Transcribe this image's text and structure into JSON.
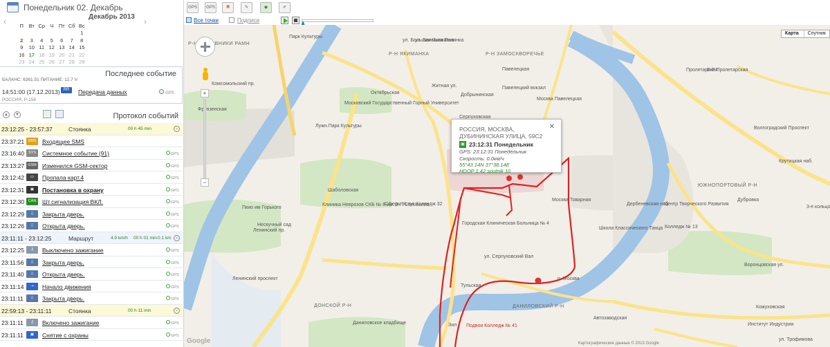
{
  "calendar": {
    "date_title": "Понедельник 02. Декабрь",
    "month_title": "Декабрь 2013",
    "weekdays": [
      "П",
      "Вт",
      "Ср",
      "Ч",
      "Пт",
      "Сб",
      "Вс"
    ],
    "weeks": [
      [
        "",
        "",
        "",
        "",
        "",
        "",
        "1"
      ],
      [
        "2",
        "3",
        "4",
        "5",
        "6",
        "7",
        "8"
      ],
      [
        "9",
        "10",
        "11",
        "12",
        "13",
        "14",
        "15"
      ],
      [
        "16",
        "17",
        "18",
        "19",
        "20",
        "21",
        "22"
      ],
      [
        "23",
        "24",
        "25",
        "26",
        "27",
        "28",
        "29"
      ],
      [
        "30",
        "31",
        "",
        "",
        "",
        "",
        ""
      ]
    ]
  },
  "last_event": {
    "title": "Последнее событие",
    "balance": "БАЛАНС: 6261.51   ПИТАНИЕ: 12.7 V",
    "time": "14:51:00 (17.12.2013)",
    "event": "Передача данных",
    "gps": "GPS",
    "region": "РОССИЯ, Р-158"
  },
  "protocol": {
    "title": "Протокол событий",
    "events": [
      {
        "kind": "group",
        "time": "23:12:25 - 23:57:37",
        "type": "Стоянка",
        "duration": "00 h 45 min"
      },
      {
        "kind": "event",
        "time": "23:37:21",
        "icon": "sms-icon",
        "icon_text": "SMS",
        "icon_color": "#e0a020",
        "label": "Входящее SMS",
        "bold": false,
        "gps": ""
      },
      {
        "kind": "event",
        "time": "23:16:40",
        "icon": "system-icon",
        "icon_text": "SYS",
        "icon_color": "#888888",
        "label": "Системное событие (91)",
        "bold": false,
        "gps": "GPS"
      },
      {
        "kind": "event",
        "time": "23:13:27",
        "icon": "gsm-icon",
        "icon_text": "GSM",
        "icon_color": "#666666",
        "label": "Изменился GSM-сектор",
        "bold": false,
        "gps": "GPS"
      },
      {
        "kind": "event",
        "time": "23:12:42",
        "icon": "card-icon",
        "icon_text": "▭",
        "icon_color": "#444444",
        "label": "Пропала карт.4",
        "bold": false,
        "gps": "GPS"
      },
      {
        "kind": "event",
        "time": "23:12:31",
        "icon": "arm-icon",
        "icon_text": "▣",
        "icon_color": "#333333",
        "label": "Постановка в охрану",
        "bold": true,
        "gps": "GPS"
      },
      {
        "kind": "event",
        "time": "23:12:30",
        "icon": "can-icon",
        "icon_text": "CAN",
        "icon_color": "#2a8a2a",
        "label": "Шт.сигнализация ВКЛ.",
        "bold": false,
        "gps": "GPS"
      },
      {
        "kind": "event",
        "time": "23:12:29",
        "icon": "door-closed-icon",
        "icon_text": "▯",
        "icon_color": "#5577aa",
        "label": "Закрыта дверь.",
        "bold": false,
        "gps": "GPS"
      },
      {
        "kind": "event",
        "time": "23:12:26",
        "icon": "door-open-icon",
        "icon_text": "▯",
        "icon_color": "#5577aa",
        "label": "Открыта дверь.",
        "bold": false,
        "gps": "GPS"
      },
      {
        "kind": "route",
        "time": "23:11:11 - 23:12:25",
        "type": "Маршрут",
        "speed": "4.9 km/h",
        "duration": "00 h 01 min",
        "distance": "0.1 km"
      },
      {
        "kind": "event",
        "time": "23:12:25",
        "icon": "ignition-off-icon",
        "icon_text": "⚷",
        "icon_color": "#8899aa",
        "label": "Выключено зажигание",
        "bold": false,
        "gps": "GPS"
      },
      {
        "kind": "event",
        "time": "23:11:56",
        "icon": "door-closed-icon",
        "icon_text": "▯",
        "icon_color": "#5577aa",
        "label": "Закрыта дверь.",
        "bold": false,
        "gps": "GPS"
      },
      {
        "kind": "event",
        "time": "23:11:40",
        "icon": "door-open-icon",
        "icon_text": "▯",
        "icon_color": "#5577aa",
        "label": "Открыта дверь.",
        "bold": false,
        "gps": "GPS"
      },
      {
        "kind": "event",
        "time": "23:11:14",
        "icon": "move-icon",
        "icon_text": "⇢",
        "icon_color": "#3366cc",
        "label": "Начало движения",
        "bold": false,
        "gps": "GPS"
      },
      {
        "kind": "event",
        "time": "23:11:11",
        "icon": "door-closed-icon",
        "icon_text": "▯",
        "icon_color": "#5577aa",
        "label": "Закрыта дверь.",
        "bold": false,
        "gps": "GPS"
      },
      {
        "kind": "group",
        "time": "22:59:13 - 23:11:11",
        "type": "Стоянка",
        "duration": "00 h 11 min"
      },
      {
        "kind": "event",
        "time": "23:11:11",
        "icon": "ignition-on-icon",
        "icon_text": "⚷",
        "icon_color": "#8899aa",
        "label": "Включено зажигание",
        "bold": false,
        "gps": "GPS"
      },
      {
        "kind": "event",
        "time": "23:11:11",
        "icon": "disarm-icon",
        "icon_text": "▣",
        "icon_color": "#3366cc",
        "label": "Снятие с охраны",
        "bold": false,
        "gps": "GPS"
      }
    ]
  },
  "toolbar": {
    "all_points": "Все точки",
    "signatures": "Подписи",
    "map_types": [
      "Карта",
      "Спутник"
    ]
  },
  "map": {
    "colors": {
      "route": "#e02020",
      "river": "#9fc4e6",
      "road": "#fbe38a"
    },
    "labels": [
      "Парк Культуры",
      "Р-Н ЯКИМАНКА",
      "Р-Н ЗАМОСКВОРЕЧЬЕ",
      "Б-Р Пролетарская",
      "Октябрьская",
      "Павелецкая",
      "Павелецкий вокзал",
      "Москва Павелецкая",
      "Добрынинская",
      "Серпуховская",
      "Житная ул.",
      "ул. Большая Полянка",
      "ул. Большая Якиманка",
      "Московский Государственный Горный Университет",
      "Лужн.Парк Культуры",
      "Фрунзенская",
      "Шаболовская",
      "Сферы Услуг Колледж 32",
      "Клиника Неврозов СКБ № 8 им. З П Соловьева",
      "Пкио им Горького",
      "Нескучный сад",
      "Ленинский проспект",
      "Городская Клиническая Больница № 4",
      "ул. Серпуховский Вал",
      "Тульская",
      "ДОНСКОЙ Р-Н",
      "ДАНИЛОВСКИЙ Р-Н",
      "Даниловское кладбище",
      "Зил",
      "Москва Товарная",
      "Автозаводская",
      "ЮЖНОПОРТОВЫЙ Р-Н",
      "Дубровка",
      "Волгоградский Проспект",
      "Школа Классического Танца",
      "Центр Творческого Развития",
      "Колледж № 13",
      "Кожуховская",
      "Институт Индустрии",
      "р. Москва",
      "3-е кольцо",
      "Пролетарская",
      "Комсомольский пр.",
      "Ленинский пр.",
      "Р-Н ХАМОВНИКИ РАМН",
      "Подвои Колледж № 41",
      "Дербеневская наб.",
      "Крутицкая наб.",
      "ул. Трофимова",
      "Воронцовская ул.",
      "ул. Дубининская"
    ]
  },
  "popup": {
    "address": "РОССИЯ, МОСКВА, ДУБИНИНСКАЯ УЛИЦА, 59С2",
    "time": "23:12:31 Понедельник",
    "gps": "GPS: 23:12:31 Понедельник",
    "speed": "Скорость: 0.0км/ч",
    "coords": "55°43.14N  37°38.14E",
    "hdop": "HDOP 1.42  sputnik 10"
  },
  "footer": {
    "google": "Google",
    "copyright": "Картографические данные © 2013 Google"
  }
}
